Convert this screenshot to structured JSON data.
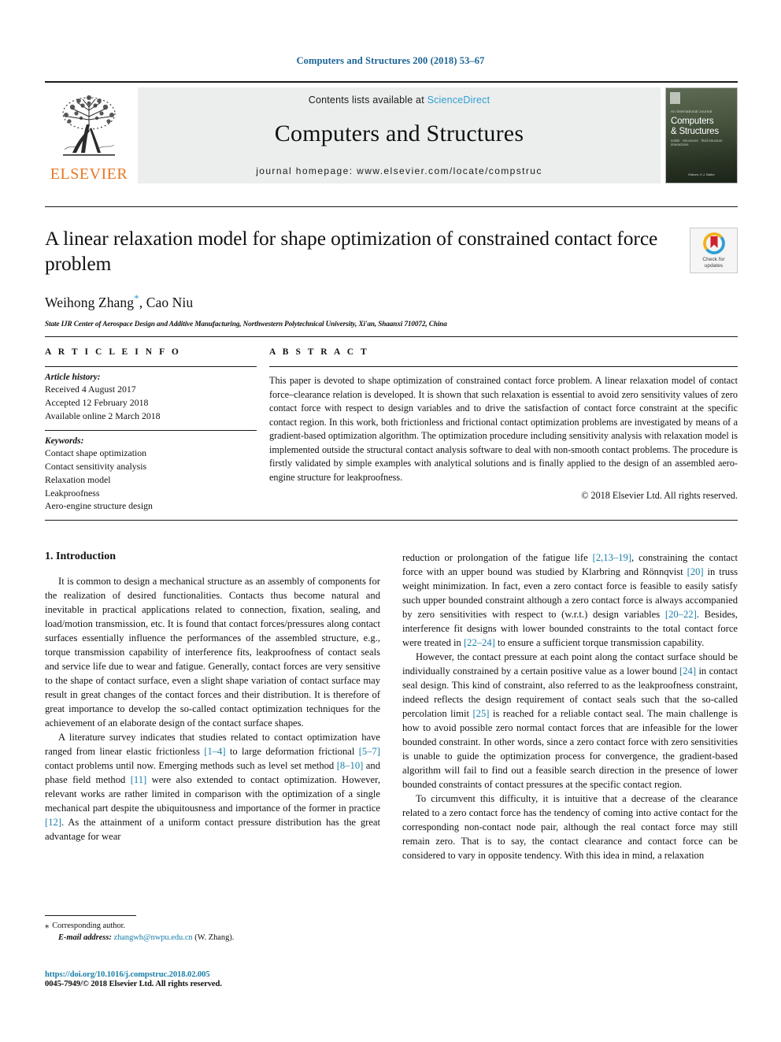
{
  "running_head": "Computers and Structures 200 (2018) 53–67",
  "masthead": {
    "publisher_name": "ELSEVIER",
    "contents_prefix": "Contents lists available at",
    "contents_link": "ScienceDirect",
    "journal_title": "Computers and Structures",
    "homepage": "journal homepage: www.elsevier.com/locate/compstruc",
    "cover": {
      "kicker": "An International Journal",
      "name_line1": "Computers",
      "name_line2": "& Structures",
      "tagline": "solids · structures · fluid-structure interactions",
      "footer": "Editors:\nK.J. Bathe"
    }
  },
  "article": {
    "title": "A linear relaxation model for shape optimization of constrained contact force problem",
    "authors": "Weihong Zhang, Cao Niu",
    "author_prefix": "Weihong Zhang",
    "author_suffix": ", Cao Niu",
    "corresponding_marker": "*",
    "affiliation": "State IJR Center of Aerospace Design and Additive Manufacturing, Northwestern Polytechnical University, Xi'an, Shaanxi 710072, China",
    "crossmark_line1": "Check for",
    "crossmark_line2": "updates"
  },
  "article_info": {
    "heading": "A R T I C L E   I N F O",
    "history_label": "Article history:",
    "history": [
      "Received 4 August 2017",
      "Accepted 12 February 2018",
      "Available online 2 March 2018"
    ],
    "keywords_label": "Keywords:",
    "keywords": [
      "Contact shape optimization",
      "Contact sensitivity analysis",
      "Relaxation model",
      "Leakproofness",
      "Aero-engine structure design"
    ]
  },
  "abstract": {
    "heading": "A B S T R A C T",
    "text": "This paper is devoted to shape optimization of constrained contact force problem. A linear relaxation model of contact force–clearance relation is developed. It is shown that such relaxation is essential to avoid zero sensitivity values of zero contact force with respect to design variables and to drive the satisfaction of contact force constraint at the specific contact region. In this work, both frictionless and frictional contact optimization problems are investigated by means of a gradient-based optimization algorithm. The optimization procedure including sensitivity analysis with relaxation model is implemented outside the structural contact analysis software to deal with non-smooth contact problems. The procedure is firstly validated by simple examples with analytical solutions and is finally applied to the design of an assembled aero-engine structure for leakproofness.",
    "copyright": "© 2018 Elsevier Ltd. All rights reserved."
  },
  "body": {
    "section_title": "1. Introduction",
    "left_paragraphs": [
      "It is common to design a mechanical structure as an assembly of components for the realization of desired functionalities. Contacts thus become natural and inevitable in practical applications related to connection, fixation, sealing, and load/motion transmission, etc. It is found that contact forces/pressures along contact surfaces essentially influence the performances of the assembled structure, e.g., torque transmission capability of interference fits, leakproofness of contact seals and service life due to wear and fatigue. Generally, contact forces are very sensitive to the shape of contact surface, even a slight shape variation of contact surface may result in great changes of the contact forces and their distribution. It is therefore of great importance to develop the so-called contact optimization techniques for the achievement of an elaborate design of the contact surface shapes.",
      "A literature survey indicates that studies related to contact optimization have ranged from linear elastic frictionless [1–4] to large deformation frictional [5–7] contact problems until now. Emerging methods such as level set method [8–10] and phase field method [11] were also extended to contact optimization. However, relevant works are rather limited in comparison with the optimization of a single mechanical part despite the ubiquitousness and importance of the former in practice [12]. As the attainment of a uniform contact pressure distribution has the great advantage for wear"
    ],
    "right_paragraphs": [
      "reduction or prolongation of the fatigue life [2,13–19], constraining the contact force with an upper bound was studied by Klarbring and Rönnqvist [20] in truss weight minimization. In fact, even a zero contact force is feasible to easily satisfy such upper bounded constraint although a zero contact force is always accompanied by zero sensitivities with respect to (w.r.t.) design variables [20–22]. Besides, interference fit designs with lower bounded constraints to the total contact force were treated in [22–24] to ensure a sufficient torque transmission capability.",
      "However, the contact pressure at each point along the contact surface should be individually constrained by a certain positive value as a lower bound [24] in contact seal design. This kind of constraint, also referred to as the leakproofness constraint, indeed reflects the design requirement of contact seals such that the so-called percolation limit [25] is reached for a reliable contact seal. The main challenge is how to avoid possible zero normal contact forces that are infeasible for the lower bounded constraint. In other words, since a zero contact force with zero sensitivities is unable to guide the optimization process for convergence, the gradient-based algorithm will fail to find out a feasible search direction in the presence of lower bounded constraints of contact pressures at the specific contact region.",
      "To circumvent this difficulty, it is intuitive that a decrease of the clearance related to a zero contact force has the tendency of coming into active contact for the corresponding non-contact node pair, although the real contact force may still remain zero. That is to say, the contact clearance and contact force can be considered to vary in opposite tendency. With this idea in mind, a relaxation"
    ]
  },
  "footnote": {
    "star": "⁎",
    "corresponding": "Corresponding author.",
    "email_label": "E-mail address:",
    "email": "zhangwh@nwpu.edu.cn",
    "email_suffix": "(W. Zhang)."
  },
  "imprint": {
    "doi": "https://doi.org/10.1016/j.compstruc.2018.02.005",
    "issn": "0045-7949/© 2018 Elsevier Ltd. All rights reserved."
  },
  "colors": {
    "link": "#1a7fa8",
    "sciencedirect": "#2e9fd4",
    "elsevier_orange": "#E87722",
    "masthead_bg": "#eceded"
  }
}
